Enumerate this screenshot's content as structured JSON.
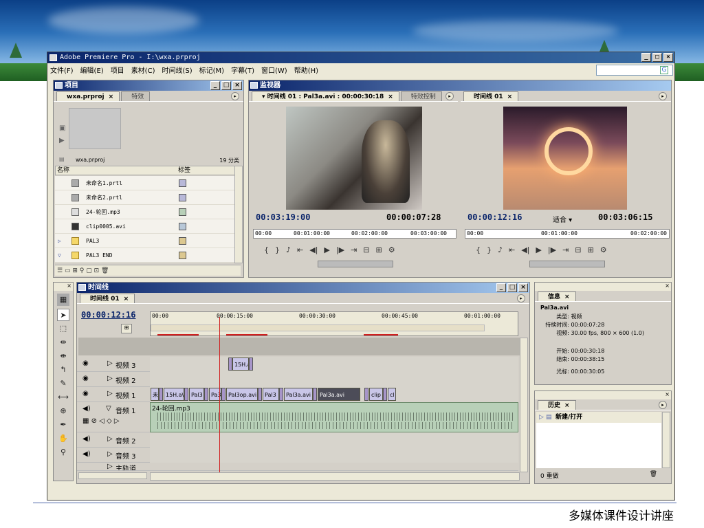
{
  "window": {
    "title": "Adobe Premiere Pro - I:\\wxa.prproj"
  },
  "menu": [
    "文件(F)",
    "编辑(E)",
    "项目",
    "素材(C)",
    "时间线(S)",
    "标记(M)",
    "字幕(T)",
    "窗口(W)",
    "帮助(H)"
  ],
  "search": {
    "placeholder": ""
  },
  "project": {
    "title": "项目",
    "tabs": [
      "wxa.prproj",
      "特效"
    ],
    "filename": "wxa.prproj",
    "count": "19 分类",
    "col_name": "名称",
    "col_label": "标签",
    "items": [
      {
        "name": "未命名1.prtl",
        "color": "#b8b8d8"
      },
      {
        "name": "未命名2.prtl",
        "color": "#b8b8d8"
      },
      {
        "name": "24-轮回.mp3",
        "color": "#b8d0b8"
      },
      {
        "name": "clip0005.avi",
        "color": "#b8c8d8"
      },
      {
        "name": "PAL3",
        "color": "#dcc890"
      },
      {
        "name": "PAL3 END",
        "color": "#dcc890"
      }
    ]
  },
  "monitor": {
    "title": "监视器",
    "source_tab": "时间线 01 : Pal3a.avi : 00:00:30:18",
    "effect_tab": "特效控制",
    "program_tab": "时间线 01",
    "source_tc": "00:03:19:00",
    "source_dur": "00:00:07:28",
    "source_ruler": [
      "00:00",
      "00:01:00:00",
      "00:02:00:00",
      "00:03:00:00"
    ],
    "program_tc": "00:00:12:16",
    "program_fit": "适合",
    "program_dur": "00:03:06:15",
    "program_ruler": [
      "00:00",
      "00:01:00:00",
      "00:02:00:00"
    ]
  },
  "timeline": {
    "title": "时间线",
    "tab": "时间线 01",
    "tc": "00:00:12:16",
    "ruler": [
      "00:00",
      "00:00:15:00",
      "00:00:30:00",
      "00:00:45:00",
      "00:01:00:00"
    ],
    "tracks": {
      "v3": "视频 3",
      "v2": "视频 2",
      "v1": "视频 1",
      "a1": "音频 1",
      "a2": "音频 2",
      "a3": "音频 3",
      "master": "主轨道"
    },
    "clips_v3": [
      "15H.a"
    ],
    "clips_v1": [
      "未",
      "15H.a\\",
      "Pal3",
      "Pa3",
      "Pal3op.avi",
      "Pal3",
      "Pal3a.avi",
      "Pal3a.avi",
      "clip",
      "cl"
    ],
    "audio_clip": "24-轮回.mp3"
  },
  "info": {
    "title": "信息",
    "file": "Pal3a.avi",
    "type_k": "类型:",
    "type_v": "视频",
    "dur_k": "持续时间:",
    "dur_v": "00:00:07:28",
    "video_k": "视频:",
    "video_v": "30.00 fps, 800 × 600 (1.0)",
    "start_k": "开始:",
    "start_v": "00:00:30:18",
    "end_k": "结束:",
    "end_v": "00:00:38:15",
    "cursor_k": "光标:",
    "cursor_v": "00:00:30:05"
  },
  "history": {
    "title": "历史",
    "item": "新建/打开",
    "count": "0 重做"
  },
  "footer": "多媒体课件设计讲座"
}
